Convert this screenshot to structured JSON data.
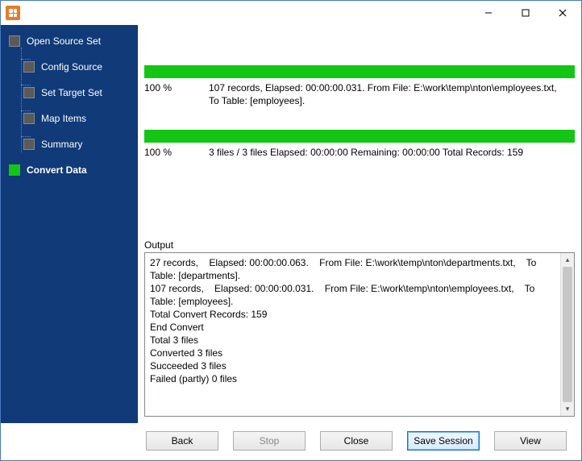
{
  "titlebar": {
    "title": ""
  },
  "sidebar": {
    "items": [
      {
        "label": "Open Source Set",
        "indent": 0,
        "active": false,
        "bold": false
      },
      {
        "label": "Config Source",
        "indent": 1,
        "active": false,
        "bold": false
      },
      {
        "label": "Set Target Set",
        "indent": 1,
        "active": false,
        "bold": false
      },
      {
        "label": "Map Items",
        "indent": 1,
        "active": false,
        "bold": false
      },
      {
        "label": "Summary",
        "indent": 1,
        "active": false,
        "bold": false
      },
      {
        "label": "Convert Data",
        "indent": 0,
        "active": true,
        "bold": true
      }
    ]
  },
  "progress1": {
    "percent": "100 %",
    "line1": "107 records,    Elapsed: 00:00:00.031.    From File: E:\\work\\temp\\nton\\employees.txt,",
    "line2": "To Table: [employees]."
  },
  "progress2": {
    "percent": "100 %",
    "text": "3 files / 3 files    Elapsed: 00:00:00    Remaining: 00:00:00    Total Records: 159"
  },
  "output": {
    "label": "Output",
    "lines": "27 records,    Elapsed: 00:00:00.063.    From File: E:\\work\\temp\\nton\\departments.txt,    To Table: [departments].\n107 records,    Elapsed: 00:00:00.031.    From File: E:\\work\\temp\\nton\\employees.txt,    To Table: [employees].\nTotal Convert Records: 159\nEnd Convert\nTotal 3 files\nConverted 3 files\nSucceeded 3 files\nFailed (partly) 0 files"
  },
  "buttons": {
    "back": "Back",
    "stop": "Stop",
    "close": "Close",
    "save": "Save Session",
    "view": "View"
  }
}
